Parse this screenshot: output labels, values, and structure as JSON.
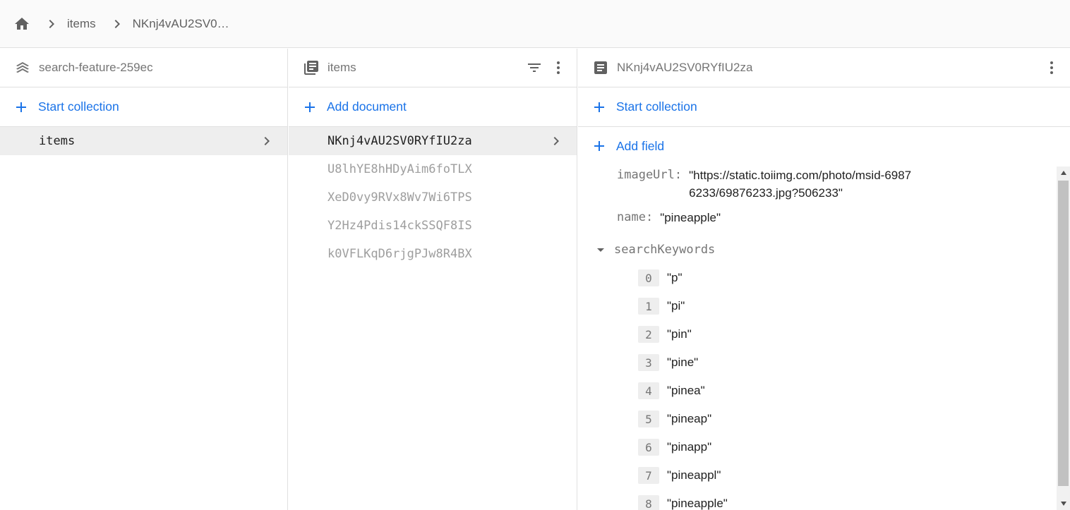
{
  "breadcrumb": {
    "home_icon": "home-icon",
    "items": [
      "items",
      "NKnj4vAU2SV0…"
    ]
  },
  "project_panel": {
    "title": "search-feature-259ec",
    "start_collection_label": "Start collection",
    "collections": [
      {
        "label": "items",
        "selected": true
      }
    ]
  },
  "collection_panel": {
    "title": "items",
    "add_document_label": "Add document",
    "documents": [
      {
        "id": "NKnj4vAU2SV0RYfIU2za",
        "selected": true
      },
      {
        "id": "U8lhYE8hHDyAim6foTLX",
        "selected": false
      },
      {
        "id": "XeD0vy9RVx8Wv7Wi6TPS",
        "selected": false
      },
      {
        "id": "Y2Hz4Pdis14ckSSQF8IS",
        "selected": false
      },
      {
        "id": "k0VFLKqD6rjgPJw8R4BX",
        "selected": false
      }
    ]
  },
  "document_panel": {
    "title": "NKnj4vAU2SV0RYfIU2za",
    "start_collection_label": "Start collection",
    "add_field_label": "Add field",
    "fields": {
      "imageUrl": {
        "key": "imageUrl:",
        "value": "\"https://static.toiimg.com/photo/msid-69876233/69876233.jpg?506233\""
      },
      "name": {
        "key": "name:",
        "value": "\"pineapple\""
      },
      "searchKeywords": {
        "key": "searchKeywords",
        "items": [
          {
            "index": "0",
            "value": "\"p\""
          },
          {
            "index": "1",
            "value": "\"pi\""
          },
          {
            "index": "2",
            "value": "\"pin\""
          },
          {
            "index": "3",
            "value": "\"pine\""
          },
          {
            "index": "4",
            "value": "\"pinea\""
          },
          {
            "index": "5",
            "value": "\"pineap\""
          },
          {
            "index": "6",
            "value": "\"pinapp\""
          },
          {
            "index": "7",
            "value": "\"pineappl\""
          },
          {
            "index": "8",
            "value": "\"pineapple\""
          }
        ]
      }
    }
  },
  "colors": {
    "accent": "#1a73e8",
    "icon": "#616161",
    "muted_text": "#757575",
    "selected_bg": "#eeeeee"
  }
}
